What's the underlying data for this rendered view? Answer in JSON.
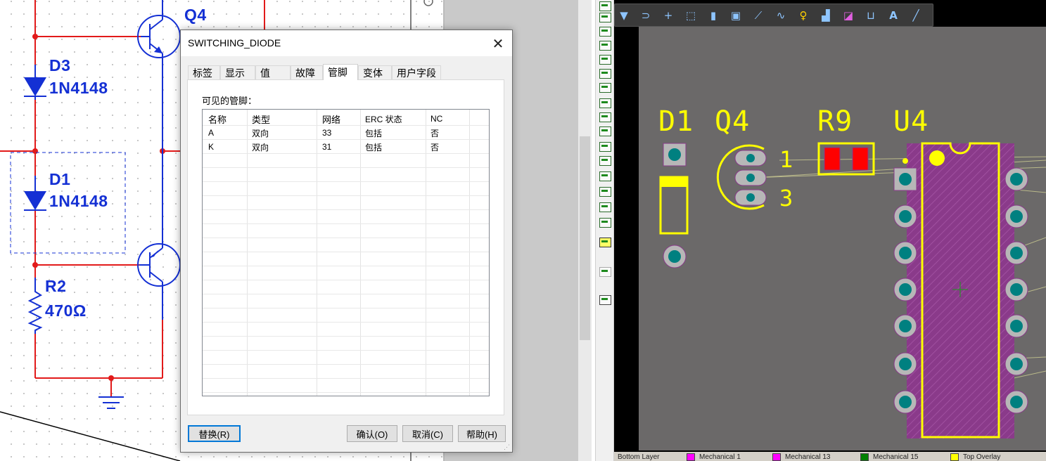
{
  "schematic": {
    "labels": {
      "q4": "Q4",
      "d3": "D3",
      "d3_value": "1N4148",
      "d1": "D1",
      "d1_value": "1N4148",
      "r2": "R2",
      "r2_value": "470Ω"
    }
  },
  "dialog": {
    "title": "SWITCHING_DIODE",
    "close_icon": "close-icon",
    "tabs": [
      "标签",
      "显示",
      "值",
      "故障",
      "管脚",
      "变体",
      "用户字段"
    ],
    "active_tab": "管脚",
    "visible_pins_label": "可见的管脚：",
    "grid": {
      "columns": [
        "名称",
        "类型",
        "网络",
        "ERC 状态",
        "NC"
      ],
      "rows": [
        [
          "A",
          "双向",
          "33",
          "包括",
          "否"
        ],
        [
          "K",
          "双向",
          "31",
          "包括",
          "否"
        ]
      ]
    },
    "buttons": {
      "replace": "替换(R)",
      "ok": "确认(O)",
      "cancel": "取消(C)",
      "help": "帮助(H)"
    }
  },
  "pcb": {
    "designators": [
      "D1",
      "Q4",
      "R9",
      "U4"
    ],
    "q4_pin_labels": [
      "1",
      "3"
    ],
    "toolbar_icons": [
      "filter-icon",
      "route-icon",
      "add-icon",
      "select-rect-icon",
      "chart-icon",
      "component-icon",
      "interactive-route-icon",
      "arc-icon",
      "pin-icon",
      "polygon-icon",
      "keepout-icon",
      "dimension-icon",
      "text-icon",
      "line-icon"
    ],
    "layer_tabs": [
      {
        "name": "Bottom Layer",
        "color": "#ffffff"
      },
      {
        "name": "Mechanical 1",
        "color": "#ff00ff"
      },
      {
        "name": "Mechanical 13",
        "color": "#ff00ff"
      },
      {
        "name": "Mechanical 15",
        "color": "#008000"
      },
      {
        "name": "Top Overlay",
        "color": "#ffff00"
      }
    ],
    "colors": {
      "board": "#6b6969",
      "silkscreen": "#ffff00",
      "pad": "#b7b7b7",
      "hole": "#008080",
      "smd_pad": "#ff0000",
      "footprint_hatch": "#8a3a8a"
    }
  }
}
